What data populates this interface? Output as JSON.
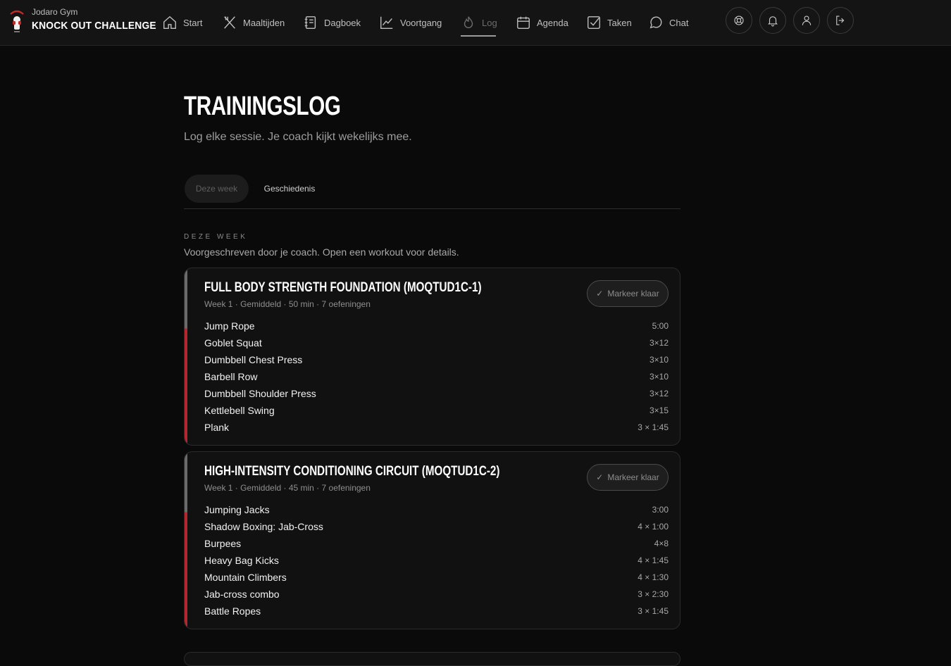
{
  "brand": {
    "subtitle": "Jodaro Gym",
    "title": "KNOCK OUT CHALLENGE"
  },
  "nav": [
    {
      "label": "Start",
      "icon": "home-icon",
      "active": false
    },
    {
      "label": "Maaltijden",
      "icon": "utensils-icon",
      "active": false
    },
    {
      "label": "Dagboek",
      "icon": "notebook-icon",
      "active": false
    },
    {
      "label": "Voortgang",
      "icon": "chart-line-icon",
      "active": false
    },
    {
      "label": "Log",
      "icon": "flame-icon",
      "active": true
    },
    {
      "label": "Agenda",
      "icon": "calendar-icon",
      "active": false
    },
    {
      "label": "Taken",
      "icon": "checkbox-icon",
      "active": false
    },
    {
      "label": "Chat",
      "icon": "chat-bubble-icon",
      "active": false
    }
  ],
  "header_actions": [
    "lifebuoy-icon",
    "bell-icon",
    "user-icon",
    "logout-icon"
  ],
  "page": {
    "title": "TRAININGSLOG",
    "subtitle": "Log elke sessie. Je coach kijkt wekelijks mee."
  },
  "tabs": [
    {
      "label": "Deze week",
      "active": true
    },
    {
      "label": "Geschiedenis",
      "active": false
    }
  ],
  "section": {
    "label": "DEZE WEEK",
    "description": "Voorgeschreven door je coach. Open een workout voor details."
  },
  "workouts": [
    {
      "title": "FULL BODY STRENGTH FOUNDATION (MOQTUD1C-1)",
      "meta": "Week 1 · Gemiddeld · 50 min · 7 oefeningen",
      "action": "Markeer klaar",
      "exercises": [
        {
          "name": "Jump Rope",
          "value": "5:00"
        },
        {
          "name": "Goblet Squat",
          "value": "3×12"
        },
        {
          "name": "Dumbbell Chest Press",
          "value": "3×10"
        },
        {
          "name": "Barbell Row",
          "value": "3×10"
        },
        {
          "name": "Dumbbell Shoulder Press",
          "value": "3×12"
        },
        {
          "name": "Kettlebell Swing",
          "value": "3×15"
        },
        {
          "name": "Plank",
          "value": "3 × 1:45"
        }
      ]
    },
    {
      "title": "HIGH-INTENSITY CONDITIONING CIRCUIT (MOQTUD1C-2)",
      "meta": "Week 1 · Gemiddeld · 45 min · 7 oefeningen",
      "action": "Markeer klaar",
      "exercises": [
        {
          "name": "Jumping Jacks",
          "value": "3:00"
        },
        {
          "name": "Shadow Boxing: Jab-Cross",
          "value": "4 × 1:00"
        },
        {
          "name": "Burpees",
          "value": "4×8"
        },
        {
          "name": "Heavy Bag Kicks",
          "value": "4 × 1:45"
        },
        {
          "name": "Mountain Climbers",
          "value": "4 × 1:30"
        },
        {
          "name": "Jab-cross combo",
          "value": "3 × 2:30"
        },
        {
          "name": "Battle Ropes",
          "value": "3 × 1:45"
        }
      ]
    }
  ],
  "colors": {
    "background": "#0a0a0a",
    "accent_red": "#b5262f",
    "card_bg": "#111111"
  }
}
